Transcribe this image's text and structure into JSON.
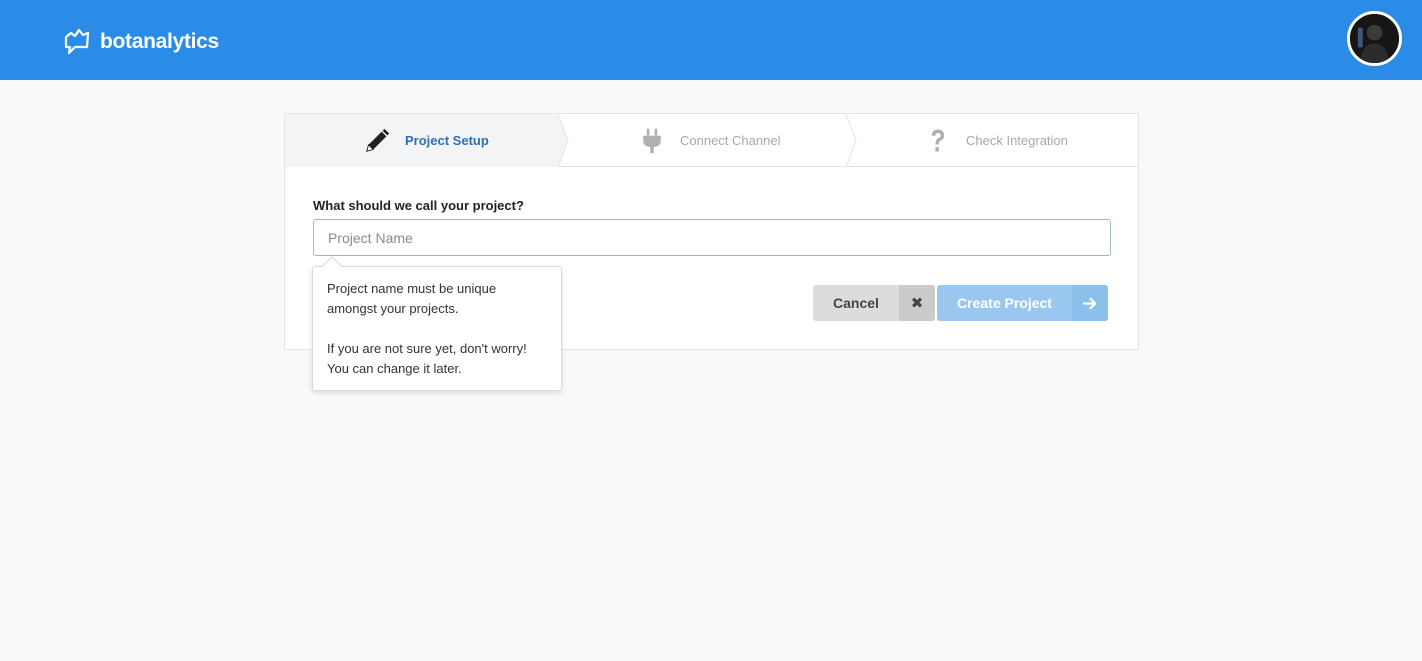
{
  "app": {
    "brand": "botanalytics"
  },
  "user": {
    "avatar": "user-avatar"
  },
  "steps": [
    {
      "label": "Project Setup",
      "icon": "pencil-icon",
      "active": true
    },
    {
      "label": "Connect Channel",
      "icon": "plug-icon",
      "active": false
    },
    {
      "label": "Check Integration",
      "icon": "question-icon",
      "active": false
    }
  ],
  "form": {
    "label": "What should we call your project?",
    "input_value": "",
    "placeholder": "Project Name"
  },
  "tooltip": {
    "line1": "Project name must be unique amongst your projects.",
    "line2": "If you are not sure yet, don't worry! You can change it later."
  },
  "buttons": {
    "cancel_label": "Cancel",
    "cancel_icon": "close-icon",
    "create_label": "Create Project",
    "create_icon": "arrow-right-icon"
  },
  "colors": {
    "header": "#2b8ce8",
    "active_step_text": "#2d6fb5",
    "create_button": "#9ac7ef",
    "cancel_button": "#dcdcdc"
  }
}
